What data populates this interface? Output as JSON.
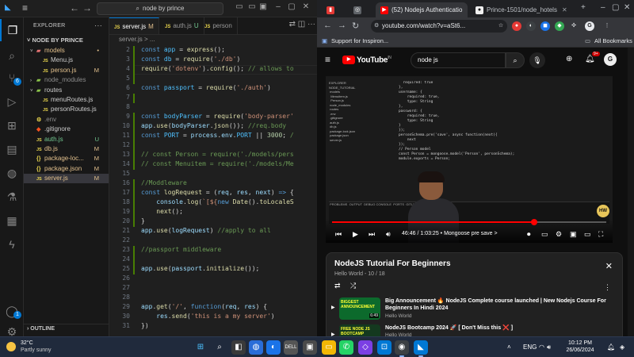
{
  "vscode": {
    "command_center": "node by prince",
    "explorer_header": "EXPLORER",
    "root_folder": "NODE BY PRINCE",
    "outline_label": "OUTLINE",
    "breadcrumb": "server.js > ...",
    "tree": [
      {
        "label": "models",
        "type": "folder",
        "open": true,
        "depth": 1,
        "status": "•",
        "color": "#e2c08d"
      },
      {
        "label": "Menu.js",
        "type": "file",
        "depth": 2,
        "status": "",
        "color": "#cccccc"
      },
      {
        "label": "person.js",
        "type": "file",
        "depth": 2,
        "status": "M",
        "color": "#e2c08d"
      },
      {
        "label": "node_modules",
        "type": "folder",
        "open": false,
        "depth": 1,
        "status": "",
        "color": "#8b8b8b"
      },
      {
        "label": "routes",
        "type": "folder",
        "open": true,
        "depth": 1,
        "status": "",
        "color": "#cccccc"
      },
      {
        "label": "menuRoutes.js",
        "type": "file",
        "depth": 2,
        "status": "",
        "color": "#cccccc"
      },
      {
        "label": "personRoutes.js",
        "type": "file",
        "depth": 2,
        "status": "",
        "color": "#cccccc"
      },
      {
        "label": ".env",
        "type": "env",
        "depth": 1,
        "status": "",
        "color": "#8b8b8b"
      },
      {
        "label": ".gitignore",
        "type": "git",
        "depth": 1,
        "status": "",
        "color": "#cccccc"
      },
      {
        "label": "auth.js",
        "type": "file",
        "depth": 1,
        "status": "U",
        "color": "#73c991"
      },
      {
        "label": "db.js",
        "type": "file",
        "depth": 1,
        "status": "M",
        "color": "#e2c08d"
      },
      {
        "label": "package-loc...",
        "type": "json",
        "depth": 1,
        "status": "M",
        "color": "#e2c08d"
      },
      {
        "label": "package.json",
        "type": "json",
        "depth": 1,
        "status": "M",
        "color": "#e2c08d"
      },
      {
        "label": "server.js",
        "type": "file",
        "depth": 1,
        "status": "M",
        "color": "#e2c08d",
        "selected": true
      }
    ],
    "tabs": [
      {
        "label": "server.js",
        "status": "M",
        "active": true
      },
      {
        "label": "auth.js",
        "status": "U",
        "active": false
      },
      {
        "label": "person",
        "status": "",
        "active": false
      }
    ],
    "code_lines": [
      {
        "n": "2",
        "html": "<span class='kw'>const</span> <span class='cn'>app</span> = <span class='fn'>express</span>();"
      },
      {
        "n": "3",
        "html": "<span class='kw'>const</span> <span class='cn'>db</span> = <span class='fn'>require</span>(<span class='st'>'./db'</span>)"
      },
      {
        "n": "4",
        "html": "<span class='fn'>require</span>(<span class='st'>'dotenv'</span>).<span class='fn'>config</span>(); <span class='cm'>// allows to</span>"
      },
      {
        "n": "5",
        "html": ""
      },
      {
        "n": "6",
        "html": "<span class='kw'>const</span> <span class='cn'>passport</span> = <span class='fn'>require</span>(<span class='st'>'./auth'</span>)"
      },
      {
        "n": "7",
        "html": ""
      },
      {
        "n": "8",
        "html": ""
      },
      {
        "n": "9",
        "html": "<span class='kw'>const</span> <span class='cn'>bodyParser</span> = <span class='fn'>require</span>(<span class='st'>'body-parser'</span>"
      },
      {
        "n": "10",
        "html": "<span class='vr'>app</span>.<span class='fn'>use</span>(<span class='vr'>bodyParser</span>.<span class='fn'>json</span>()); <span class='cm'>//req.body</span>"
      },
      {
        "n": "11",
        "html": "<span class='kw'>const</span> <span class='cn'>PORT</span> = <span class='vr'>process</span>.<span class='vr'>env</span>.<span class='cn'>PORT</span> || <span class='nm'>3000</span>; <span class='cm'>/</span>"
      },
      {
        "n": "12",
        "html": ""
      },
      {
        "n": "13",
        "html": "<span class='cm'>// const Person = require('./models/pers</span>"
      },
      {
        "n": "14",
        "html": "<span class='cm'>// const Menuitem = require('./models/Me</span>"
      },
      {
        "n": "15",
        "html": ""
      },
      {
        "n": "16",
        "html": "<span class='cm'>//Moddleware</span>"
      },
      {
        "n": "17",
        "html": "<span class='kw'>const</span> <span class='fn'>logRequest</span> = (<span class='vr'>req</span>, <span class='vr'>res</span>, <span class='vr'>next</span>) <span class='kw'>=&gt;</span> {"
      },
      {
        "n": "18",
        "html": "    <span class='vr'>console</span>.<span class='fn'>log</span>(<span class='st'>`[${</span><span class='kw'>new</span> <span class='fn'>Date</span>().<span class='fn'>toLocaleS</span>"
      },
      {
        "n": "19",
        "html": "    <span class='fn'>next</span>();"
      },
      {
        "n": "20",
        "html": "}"
      },
      {
        "n": "21",
        "html": "<span class='vr'>app</span>.<span class='fn'>use</span>(<span class='vr'>logRequest</span>) <span class='cm'>//apply to all</span>"
      },
      {
        "n": "22",
        "html": ""
      },
      {
        "n": "23",
        "html": "<span class='cm'>//passport middleware</span>"
      },
      {
        "n": "24",
        "html": ""
      },
      {
        "n": "25",
        "html": "<span class='vr'>app</span>.<span class='fn'>use</span>(<span class='vr'>passport</span>.<span class='fn'>initialize</span>());"
      },
      {
        "n": "26",
        "html": ""
      },
      {
        "n": "27",
        "html": ""
      },
      {
        "n": "28",
        "html": ""
      },
      {
        "n": "29",
        "html": "<span class='vr'>app</span>.<span class='fn'>get</span>(<span class='st'>'/'</span>, <span class='kw'>function</span>(<span class='vr'>req</span>, <span class='vr'>res</span>) {"
      },
      {
        "n": "30",
        "html": "    <span class='vr'>res</span>.<span class='fn'>send</span>(<span class='st'>'this is a my server'</span>)"
      },
      {
        "n": "31",
        "html": "})"
      }
    ]
  },
  "chrome": {
    "tabs": [
      {
        "label": "",
        "fav_color": "#e53935",
        "fav_glyph": "▮"
      },
      {
        "label": "",
        "fav_color": "#5f6368",
        "fav_glyph": "◎"
      },
      {
        "label": "(52) Nodejs Authenticatio",
        "fav_color": "#ff0000",
        "fav_glyph": "▶",
        "active": true
      },
      {
        "label": "Prince-1501/node_hotels",
        "fav_color": "#f0f0f0",
        "fav_glyph": "●"
      }
    ],
    "url": "youtube.com/watch?v=aSt6...",
    "bookmark": "Support for Inspiron...",
    "all_bookmarks": "All Bookmarks"
  },
  "youtube": {
    "logo_text": "YouTube",
    "logo_region": "IN",
    "search_value": "node js",
    "notification_count": "9+",
    "avatar_letter": "G",
    "time_display": "46:46 / 1:03:25",
    "chapter": "• Mongoose pre save >",
    "progress": 0.737,
    "playlist_title": "NodeJS Tutorial For Beginners",
    "playlist_sub": "Hello World - 10 / 18",
    "items": [
      {
        "title": "Big Announcement 🔥 NodeJS Complete course launched | New Nodejs Course For Beginners In Hindi 2024",
        "channel": "Hello World",
        "thumb_text": "BIGGEST ANNOUNCEMENT",
        "duration": "6:49"
      },
      {
        "title": "NodeJS Bootcamp 2024 🚀 [ Don't Miss this ❌ ]",
        "channel": "Hello World",
        "thumb_text": "FREE NODE JS BOOTCAMP",
        "duration": "1:56"
      }
    ]
  },
  "taskbar": {
    "temp": "32°C",
    "condition": "Partly sunny",
    "language": "ENG",
    "time": "10:12 PM",
    "date": "26/06/2024"
  }
}
